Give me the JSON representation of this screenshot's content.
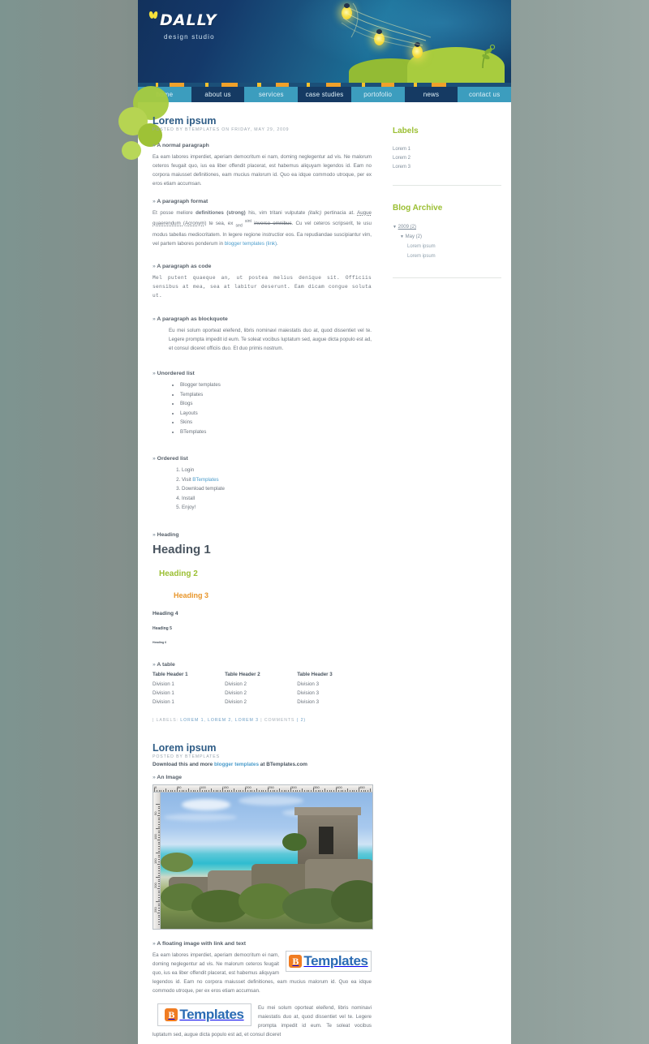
{
  "site": {
    "logo_word": "DALLY",
    "logo_sub": "design studio",
    "nav": [
      {
        "label": "home",
        "style": "lt"
      },
      {
        "label": "about us",
        "style": "dk"
      },
      {
        "label": "services",
        "style": "lt"
      },
      {
        "label": "case studies",
        "style": "dk"
      },
      {
        "label": "portofolio",
        "style": "lt"
      },
      {
        "label": "news",
        "style": "dk"
      },
      {
        "label": "contact us",
        "style": "lt"
      }
    ],
    "colors": {
      "header_dark": "#12315c",
      "header_light": "#1a6d95",
      "nav_light": "#3c9dbe",
      "nav_dark": "#153a63",
      "accent_green": "#9bbf33",
      "accent_orange": "#e8962b",
      "link_blue": "#4b9ccb",
      "title_blue": "#2e5c86",
      "page_bg": "#7d9490"
    }
  },
  "post1": {
    "title": "Lorem ipsum",
    "meta": "POSTED BY BTEMPLATES ON FRIDAY, MAY 29, 2009",
    "sec_normal": "A normal paragraph",
    "para_normal": "Ea eam labores imperdiet, aperiam democritum ei nam, doming neglegentur ad vis. Ne malorum ceteros feugait quo, ius ea liber offendit placerat, est habemus aliquyam legendos id. Eam no corpora maiusset definitiones, eam mucius malorum id. Quo ea idque commodo utroque, per ex eros etiam accumsan.",
    "sec_format": "A paragraph format",
    "fmt": {
      "t1": "Et posse meliore ",
      "strong": "definitiones (strong)",
      "t2": " his, vim tritani vulputate ",
      "italic": "(italic)",
      "t3": " pertinacia at. ",
      "acronym": "Augue quaerendum (Acronym)",
      "t4": " te sea, ex ",
      "sub": "sed",
      "t5": " ",
      "sup": "sint",
      "t6": " ",
      "strike": "inverso omnibus",
      "t7": ". Cu vel ceteros scripserit, te usu modus tabellas mediocritatem. In legere regione instructior eos. Ea repudiandae suscipiantur vim, vel partem labores ponderum in ",
      "link": "blogger templates (link)",
      "t8": "."
    },
    "sec_code": "A paragraph as code",
    "code_text": "Mel  putent  quaeque  an,  ut  postea  melius  denique  sit.  Officiis sensibus at mea, sea at labitur deserunt. Eam dicam congue soluta ut.",
    "sec_quote": "A paragraph as blockquote",
    "quote_text": "Eu mei solum oporteat eleifend, libris nominavi maiestatis duo at, quod dissentiet vel te. Legere prompta impedit id eum. Te soleat vocibus luptatum sed, augue dicta populo est ad, et consul diceret officiis duo. Et duo primis nostrum.",
    "sec_ul": "Unordered list",
    "ul_items": [
      "Blogger templates",
      "Templates",
      "Blogs",
      "Layouts",
      "Skins",
      "BTemplates"
    ],
    "sec_ol": "Ordered list",
    "ol_items": [
      "Login",
      "Visit BTemplates",
      "Download template",
      "Install",
      "Enjoy!"
    ],
    "ol_link_index": 1,
    "sec_heading": "Heading",
    "h1": "Heading 1",
    "h2": "Heading 2",
    "h3": "Heading 3",
    "h4": "Heading 4",
    "h5": "Heading 5",
    "h6": "Heading 6",
    "sec_table": "A table",
    "table": {
      "headers": [
        "Table Header 1",
        "Table Header 2",
        "Table Header 3"
      ],
      "rows": [
        [
          "Division 1",
          "Division 2",
          "Division 3"
        ],
        [
          "Division 1",
          "Division 2",
          "Division 3"
        ],
        [
          "Division 1",
          "Division 2",
          "Division 3"
        ]
      ]
    },
    "footer_pre": "| LABELS: ",
    "footer_labels": "LOREM 1, LOREM 2, LOREM 3",
    "footer_mid": " | COMMENTS ",
    "footer_comments": "( 2)"
  },
  "post2": {
    "title": "Lorem ipsum",
    "meta": "POSTED BY BTEMPLATES",
    "dl_pre": "Download this and more ",
    "dl_link": "blogger templates",
    "dl_post": " at BTemplates.com",
    "sec_image": "An Image",
    "image": {
      "ruler_h_labels": [
        "0",
        "50",
        "100",
        "150",
        "200",
        "250",
        "300",
        "350",
        "400",
        "450"
      ],
      "ruler_v_labels": [
        "50",
        "100",
        "150",
        "200",
        "250"
      ]
    },
    "sec_float": "A floating image with link and text",
    "float_para_1": "Ea eam labores imperdiet, aperiam democritum ei nam, doming neglegentur ad vis. Ne malorum ceteros feugait quo, ius ea liber offendit placerat, est habemus aliquyam legendos id. Eam no corpora maiusset definitiones, eam mucius malorum id. Quo ea idque commodo utroque, per ex eros etiam accumsan.",
    "float_para_2": "Eu mei solum oporteat eleifend, libris nominavi maiestatis duo at, quod dissentiet vel te. Legere prompta impedit id eum. Te soleat vocibus luptatum sed, augue dicta populo est ad, et consul diceret",
    "bt_mark": "B",
    "bt_word": "Templates"
  },
  "sidebar": {
    "labels_title": "Labels",
    "labels": [
      "Lorem 1",
      "Lorem 2",
      "Lorem 3"
    ],
    "archive_title": "Blog Archive",
    "archive_year": "2009 (2)",
    "archive_month": "May (2)",
    "archive_posts": [
      "Lorem ipsum",
      "Lorem ipsum"
    ],
    "toggle_icon": "▼"
  }
}
